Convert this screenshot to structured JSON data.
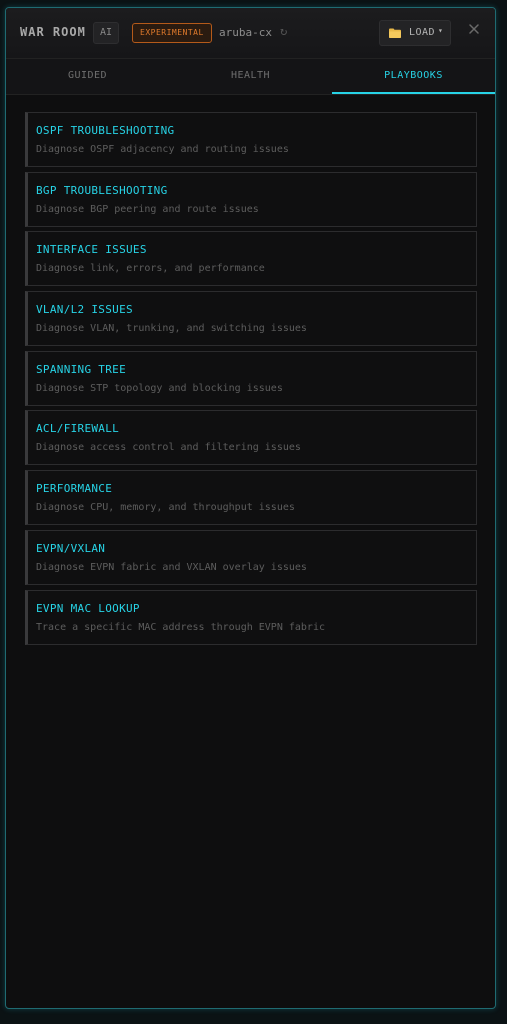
{
  "header": {
    "title": "WAR ROOM",
    "ai_badge": "AI",
    "experimental_badge": "EXPERIMENTAL",
    "device": "aruba-cx",
    "refresh_symbol": "↻",
    "load_label": "LOAD",
    "load_caret": "▾",
    "icons": [
      "refresh-icon",
      "folder-icon",
      "chevron-down-icon",
      "close-icon"
    ]
  },
  "tabs": [
    {
      "label": "GUIDED",
      "active": false
    },
    {
      "label": "HEALTH",
      "active": false
    },
    {
      "label": "PLAYBOOKS",
      "active": true
    }
  ],
  "playbooks": [
    {
      "title": "OSPF TROUBLESHOOTING",
      "description": "Diagnose OSPF adjacency and routing issues"
    },
    {
      "title": "BGP TROUBLESHOOTING",
      "description": "Diagnose BGP peering and route issues"
    },
    {
      "title": "INTERFACE ISSUES",
      "description": "Diagnose link, errors, and performance"
    },
    {
      "title": "VLAN/L2 ISSUES",
      "description": "Diagnose VLAN, trunking, and switching issues"
    },
    {
      "title": "SPANNING TREE",
      "description": "Diagnose STP topology and blocking issues"
    },
    {
      "title": "ACL/FIREWALL",
      "description": "Diagnose access control and filtering issues"
    },
    {
      "title": "PERFORMANCE",
      "description": "Diagnose CPU, memory, and throughput issues"
    },
    {
      "title": "EVPN/VXLAN",
      "description": "Diagnose EVPN fabric and VXLAN overlay issues"
    },
    {
      "title": "EVPN MAC LOOKUP",
      "description": "Trace a specific MAC address through EVPN fabric"
    }
  ],
  "colors": {
    "accent": "#27d3e6",
    "experimental": "#e07a2c",
    "background": "#0e0e0f"
  }
}
